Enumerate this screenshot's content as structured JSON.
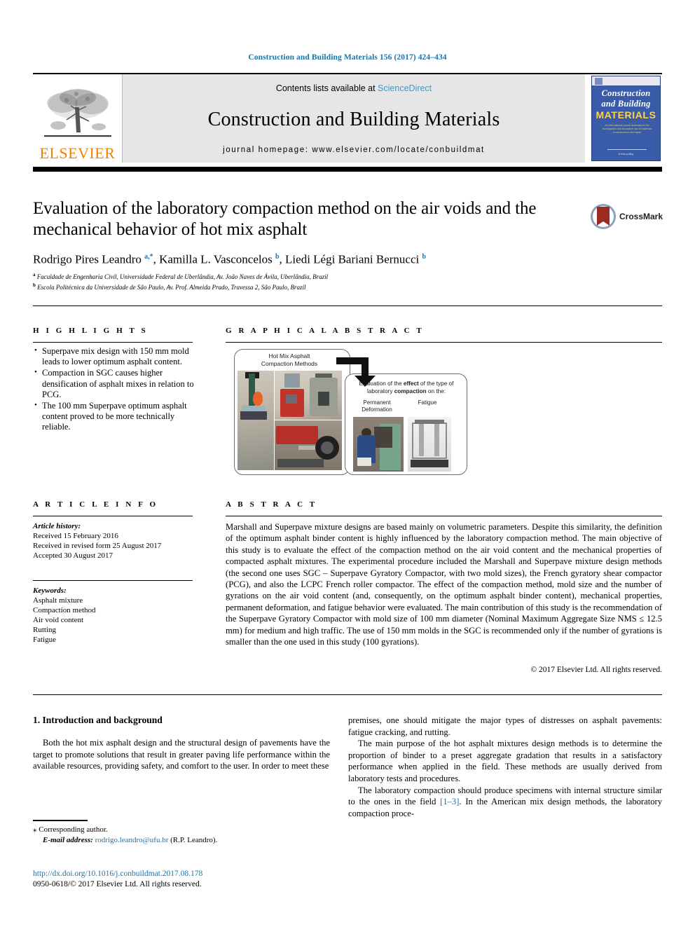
{
  "running_head": "Construction and Building Materials 156 (2017) 424–434",
  "masthead": {
    "publisher_name": "ELSEVIER",
    "contents_line_prefix": "Contents lists available at ",
    "sciencedirect": "ScienceDirect",
    "journal_title": "Construction and Building Materials",
    "homepage": "journal homepage: www.elsevier.com/locate/conbuildmat",
    "cover": {
      "line1": "Construction",
      "line2": "and Building",
      "line3": "MATERIALS",
      "blurb": "An international journal dedicated to the investigation and innovative use of materials in construction and repair",
      "footer": "A free policy"
    }
  },
  "article": {
    "title": "Evaluation of the laboratory compaction method on the air voids and the mechanical behavior of hot mix asphalt",
    "crossmark_label": "CrossMark",
    "authors_html": "Rodrigo Pires Leandro <sup>a,*</sup>, Kamilla L. Vasconcelos <sup>b</sup>, Liedi Légi Bariani Bernucci <sup>b</sup>",
    "affiliation_a": "Faculdade de Engenharia Civil, Universidade Federal de Uberlândia, Av. João Naves de Ávila, Uberlândia, Brazil",
    "affiliation_b": "Escola Politécnica da Universidade de São Paulo, Av. Prof. Almeida Prado, Travessa 2, São Paulo, Brazil"
  },
  "sections": {
    "highlights_heading": "H I G H L I G H T S",
    "graphical_abstract_heading": "G R A P H I C A L   A B S T R A C T",
    "article_info_heading": "A R T I C L E   I N F O",
    "abstract_heading": "A B S T R A C T"
  },
  "highlights": [
    "Superpave mix design with 150 mm mold leads to lower optimum asphalt content.",
    "Compaction in SGC causes higher densification of asphalt mixes in relation to PCG.",
    "The 100 mm Superpave optimum asphalt content proved to be more technically reliable."
  ],
  "graphical_abstract": {
    "left_box_label": "Hot Mix Asphalt\nCompaction Methods",
    "right_box_text_part1": "Evaluation of the ",
    "right_box_bold1": "effect",
    "right_box_text_part2": " of the type of laboratory ",
    "right_box_bold2": "compaction",
    "right_box_text_part3": " on the:",
    "sub_label_1": "Permanent\nDeformation",
    "sub_label_2": "Fatigue"
  },
  "article_info": {
    "history_label": "Article history:",
    "received": "Received 15 February 2016",
    "revised": "Received in revised form 25 August 2017",
    "accepted": "Accepted 30 August 2017",
    "keywords_label": "Keywords:",
    "keywords": [
      "Asphalt mixture",
      "Compaction method",
      "Air void content",
      "Rutting",
      "Fatigue"
    ]
  },
  "abstract": {
    "text": "Marshall and Superpave mixture designs are based mainly on volumetric parameters. Despite this similarity, the definition of the optimum asphalt binder content is highly influenced by the laboratory compaction method. The main objective of this study is to evaluate the effect of the compaction method on the air void content and the mechanical properties of compacted asphalt mixtures. The experimental procedure included the Marshall and Superpave mixture design methods (the second one uses SGC – Superpave Gyratory Compactor, with two mold sizes), the French gyratory shear compactor (PCG), and also the LCPC French roller compactor. The effect of the compaction method, mold size and the number of gyrations on the air void content (and, consequently, on the optimum asphalt binder content), mechanical properties, permanent deformation, and fatigue behavior were evaluated. The main contribution of this study is the recommendation of the Superpave Gyratory Compactor with mold size of 100 mm diameter (Nominal Maximum Aggregate Size NMS ≤ 12.5 mm) for medium and high traffic. The use of 150 mm molds in the SGC is recommended only if the number of gyrations is smaller than the one used in this study (100 gyrations).",
    "copyright": "© 2017 Elsevier Ltd. All rights reserved."
  },
  "body": {
    "section_title": "1. Introduction and background",
    "left_paragraph_1": "Both the hot mix asphalt design and the structural design of pavements have the target to promote solutions that result in greater paving life performance within the available resources, providing safety, and comfort to the user. In order to meet these",
    "right_paragraph_1": "premises, one should mitigate the major types of distresses on asphalt pavements: fatigue cracking, and rutting.",
    "right_paragraph_2": "The main purpose of the hot asphalt mixtures design methods is to determine the proportion of binder to a preset aggregate gradation that results in a satisfactory performance when applied in the field. These methods are usually derived from laboratory tests and procedures.",
    "right_paragraph_3_before": "The laboratory compaction should produce specimens with internal structure similar to the ones in the field ",
    "right_paragraph_3_cite": "[1–3]",
    "right_paragraph_3_after": ". In the American mix design methods, the laboratory compaction proce-"
  },
  "footer": {
    "corresponding_marker": "⁎",
    "corresponding_label": "Corresponding author.",
    "email_label": "E-mail address:",
    "email": "rodrigo.leandro@ufu.br",
    "email_suffix": "(R.P. Leandro).",
    "doi": "http://dx.doi.org/10.1016/j.conbuildmat.2017.08.178",
    "issn_line": "0950-0618/© 2017 Elsevier Ltd. All rights reserved."
  },
  "colors": {
    "link_blue": "#1a74a8",
    "sciencedirect_blue": "#2e9fd4",
    "elsevier_orange": "#ef8200",
    "cover_blue": "#3a5ca8",
    "cover_yellow": "#ffd34d"
  }
}
